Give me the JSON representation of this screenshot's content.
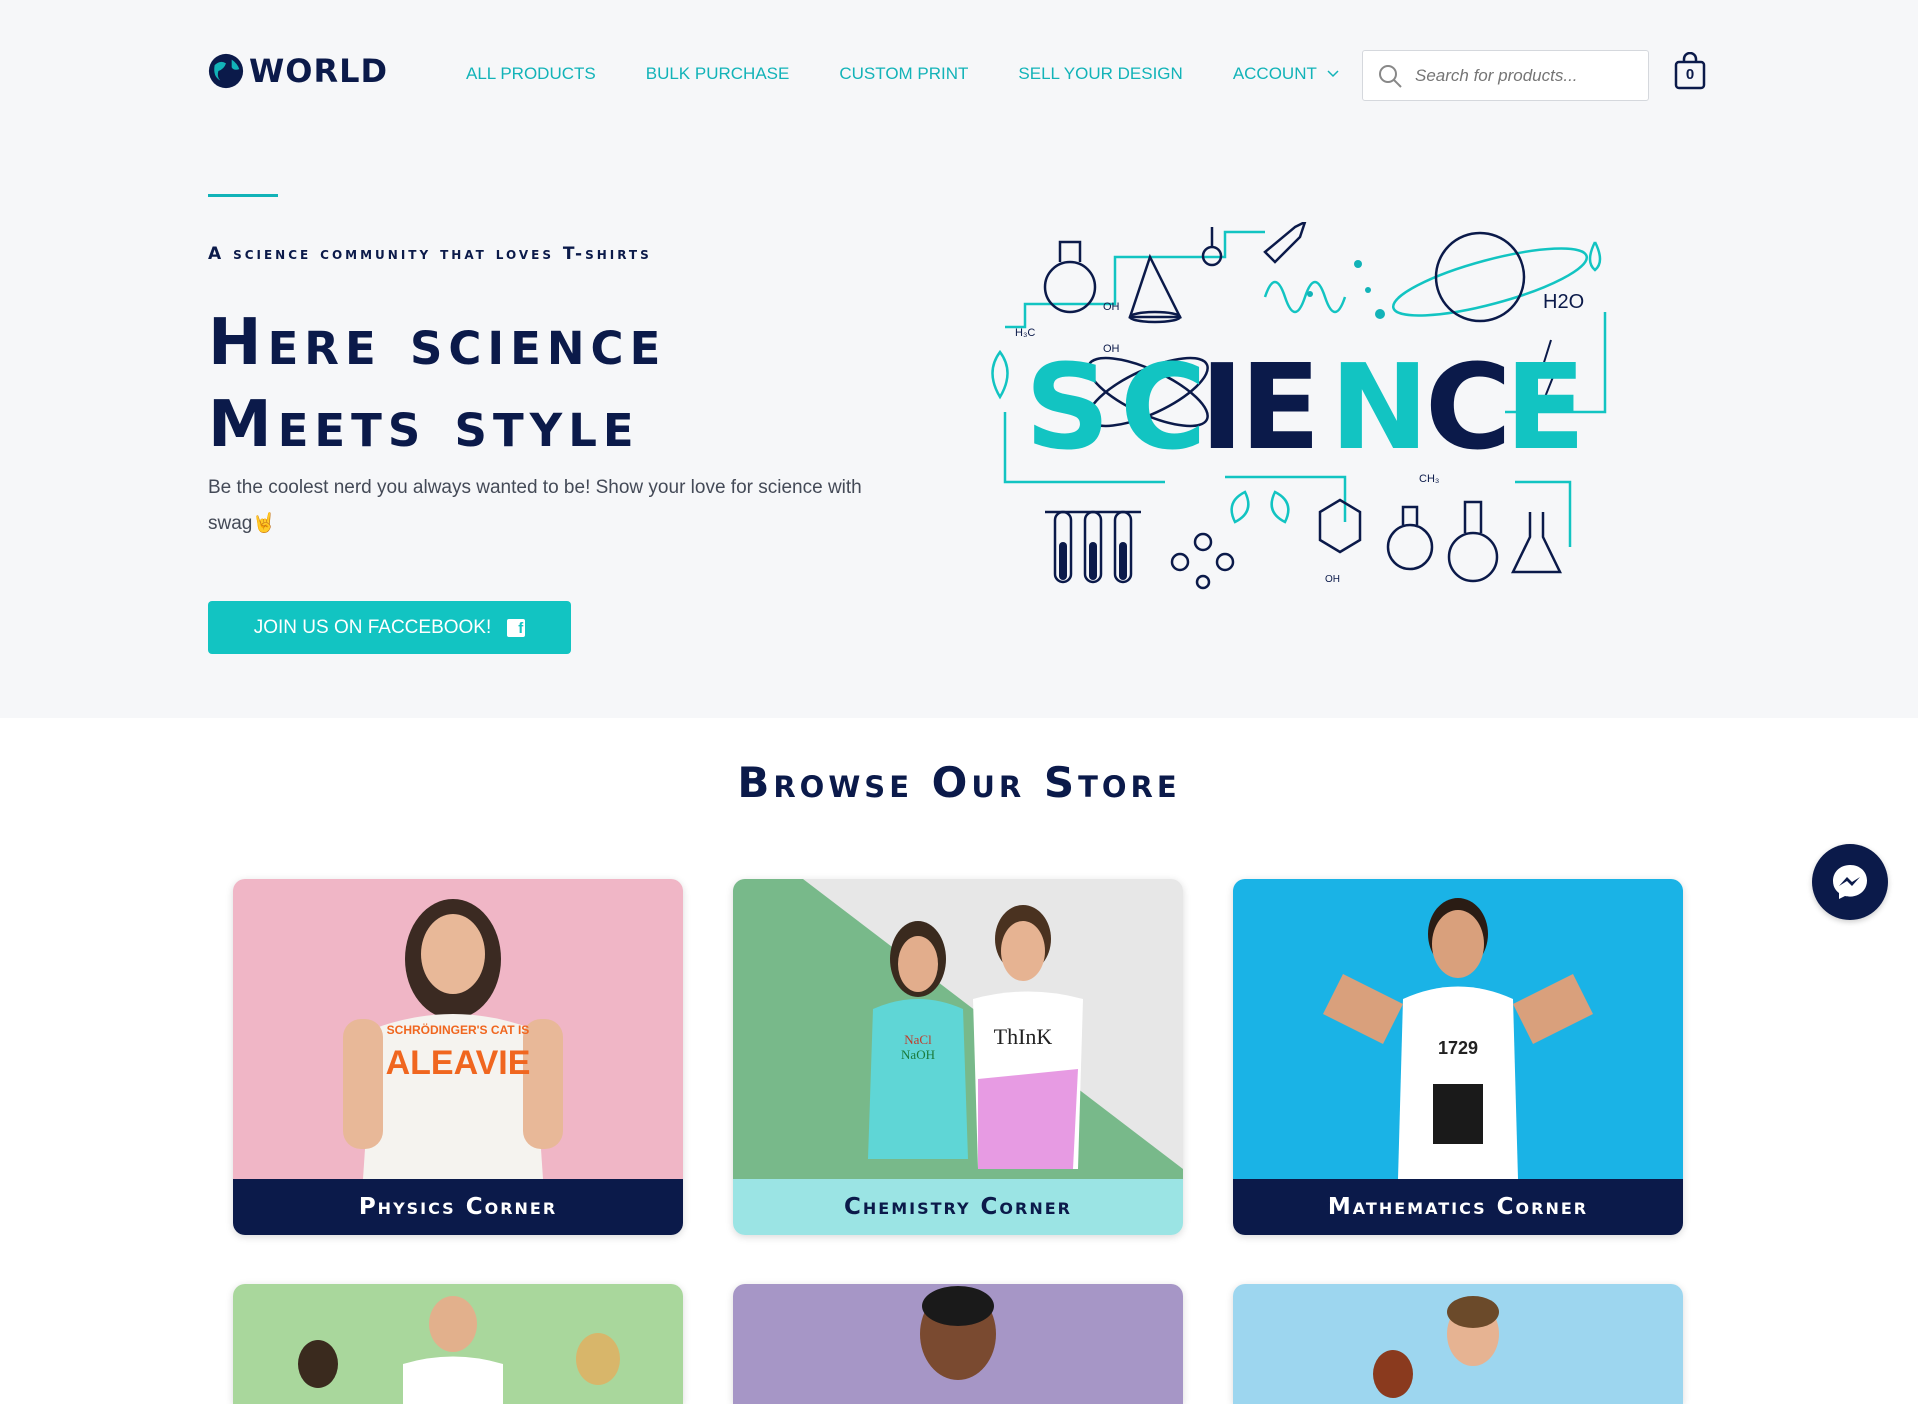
{
  "header": {
    "logo_text": "WORLD",
    "nav": [
      "ALL PRODUCTS",
      "BULK PURCHASE",
      "CUSTOM PRINT",
      "SELL YOUR DESIGN",
      "ACCOUNT"
    ],
    "search_placeholder": "Search for products...",
    "cart_count": "0"
  },
  "hero": {
    "tagline": "A science community that loves T-shirts",
    "headline_line1": "Here science",
    "headline_line2": "Meets style",
    "subtext": "Be the coolest nerd you always wanted to be! Show your love for science with swag🤘",
    "button_label": "JOIN US ON FACCEBOOK!",
    "art_word": "SCIENCE",
    "art_h2o": "H2O"
  },
  "store": {
    "title": "Browse Our Store",
    "cards": [
      {
        "label": "Physics Corner",
        "shirt_text": "SCHRÖDINGER'S CAT IS ALEAVIE"
      },
      {
        "label": "Chemistry Corner",
        "shirt_text": "ThInK"
      },
      {
        "label": "Mathematics Corner",
        "shirt_text": "1729"
      }
    ]
  },
  "colors": {
    "navy": "#0b1a4a",
    "teal": "#12b3b8",
    "teal_light": "#9be4e4",
    "pink": "#f0b6c6"
  },
  "icons": {
    "search": "search-icon",
    "cart": "bag-icon",
    "messenger": "messenger-icon",
    "facebook": "facebook-icon",
    "chevron": "chevron-down-icon"
  }
}
